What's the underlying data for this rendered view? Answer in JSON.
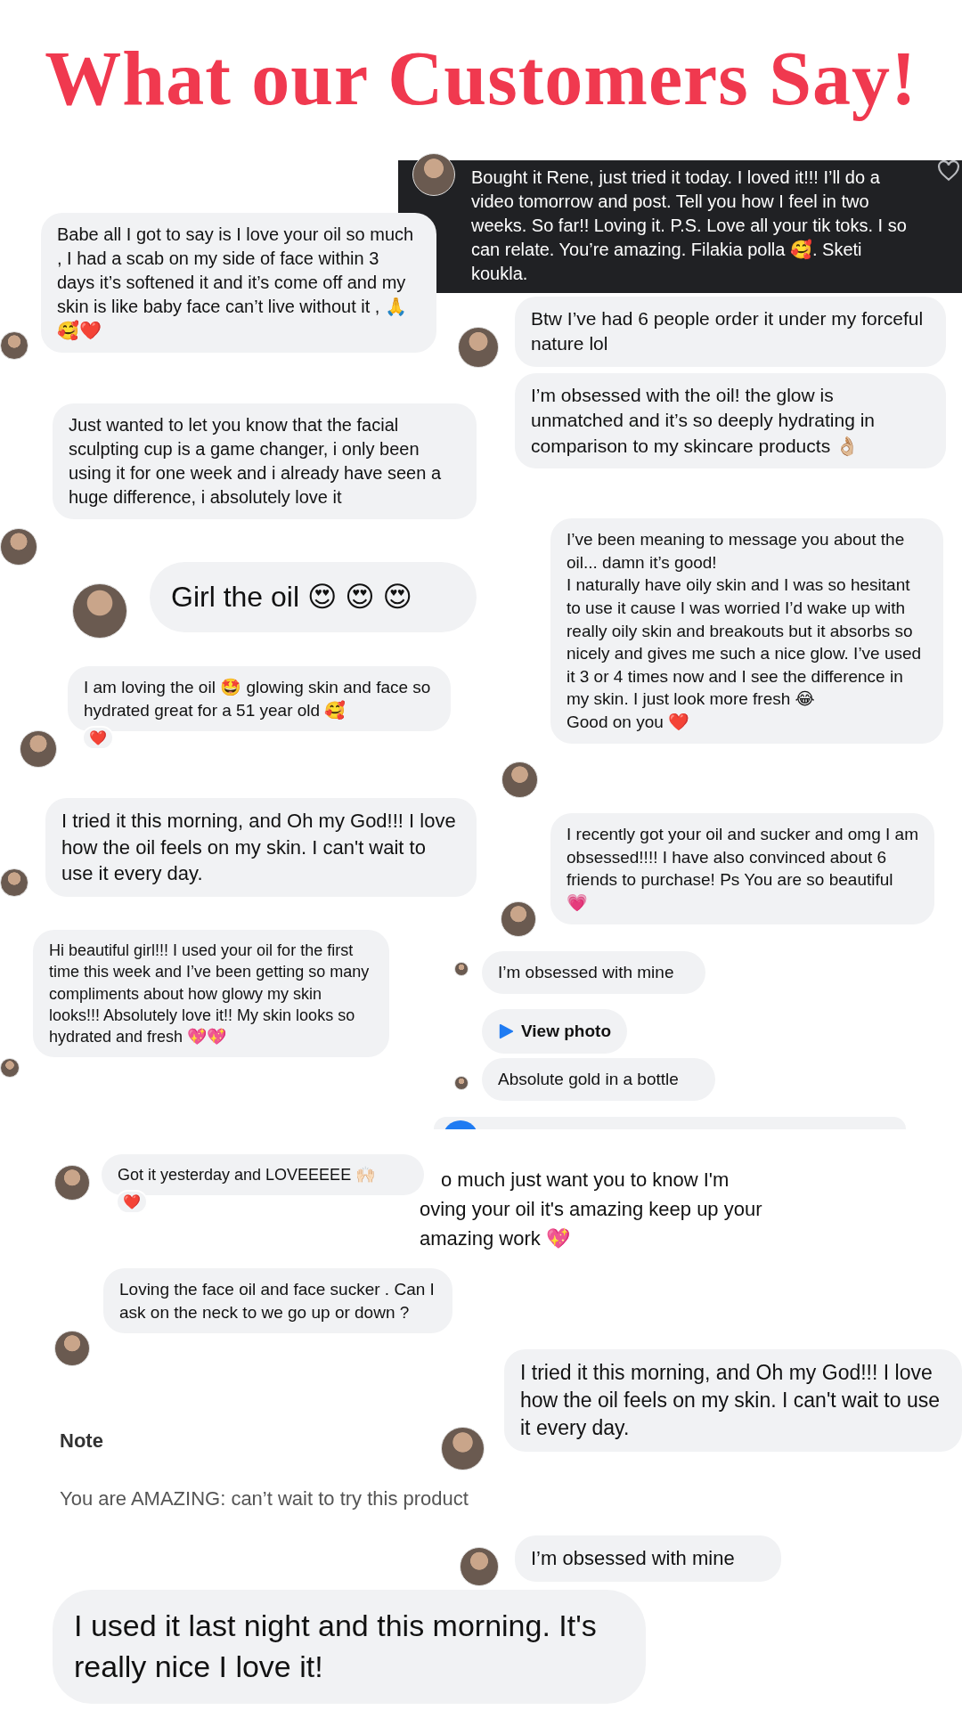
{
  "title": "What our Customers Say!",
  "messages": [
    {
      "kind": "dark",
      "text": "Bought it Rene, just tried it today. I loved it!!! I’ll do a video tomorrow and post. Tell you how I feel in two weeks. So far!! Loving it. P.S. Love all your tik toks. I so can relate. You’re amazing. Filakia polla 🥰. Sketi koukla.",
      "avatar": true
    },
    {
      "kind": "bubble",
      "text": "Babe all I got to say is I love your oil so much , I had a scab on my side of face within 3 days it’s softened it and it’s come off and my skin is like baby face can’t live without it , 🙏🥰❤️",
      "avatar": true
    },
    {
      "kind": "bubble",
      "text": "Btw I’ve had 6 people order it under my forceful nature lol",
      "avatar": true
    },
    {
      "kind": "bubble",
      "text": "I’m obsessed with the oil! the glow is unmatched and it’s so deeply hydrating in comparison to my skincare products 👌🏼",
      "avatar": false
    },
    {
      "kind": "bubble",
      "text": "Just wanted to let you know that the facial sculpting cup is a game changer, i only been using it for one week and i already have seen a huge difference, i absolutely love it",
      "avatar": true
    },
    {
      "kind": "large",
      "text": "Girl the oil 😍 😍 😍",
      "avatar": true
    },
    {
      "kind": "bubble",
      "text": "I am loving the oil 🤩 glowing skin and face so hydrated great for a 51 year old 🥰",
      "avatar": true,
      "reaction": "❤️"
    },
    {
      "kind": "bubble",
      "text": "I’ve been meaning to message you about the oil... damn it’s good!\nI naturally have oily skin and I was so hesitant to use it cause I was worried I’d wake up with really oily skin and breakouts but it absorbs so nicely and gives me such a nice glow. I’ve used it 3 or 4 times now and I see the difference in my skin. I just look more fresh 😂\nGood on you ❤️",
      "avatar": true
    },
    {
      "kind": "bubble",
      "text": "I tried it this morning, and Oh my God!!! I love how the oil feels on my skin. I can't wait to use it every day.",
      "avatar": true
    },
    {
      "kind": "bubble",
      "text": "I recently got your oil and sucker and omg I am obsessed!!!! I have also convinced about 6 friends to purchase! Ps You are so beautiful 💗",
      "avatar": true
    },
    {
      "kind": "bubble",
      "text": "Hi beautiful girl!!! I used your oil for the first time this week and I’ve been getting so many compliments about how glowy my skin looks!!! Absolutely love it!! My skin looks so hydrated and fresh 💖💖",
      "avatar": true
    },
    {
      "kind": "bubble",
      "text": "I’m obsessed with mine",
      "avatar": true
    },
    {
      "kind": "link",
      "text": "View photo",
      "avatar": false
    },
    {
      "kind": "bubble",
      "text": "Absolute gold in a bottle",
      "avatar": true
    },
    {
      "kind": "bubble",
      "text": "Got it yesterday and LOVEEEEE 🙌🏻",
      "avatar": true,
      "reaction": "❤️"
    },
    {
      "kind": "plain",
      "text": "o much just want you to know I'm\noving your oil it's amazing keep up your\namazing work 💖",
      "avatar": false
    },
    {
      "kind": "bubble",
      "text": "Loving the face oil and face sucker . Can I ask on the neck to we go up or down ?",
      "avatar": true
    },
    {
      "kind": "bubble",
      "text": "I tried it this morning, and Oh my God!!! I love how the oil feels on my skin. I can't wait to use it every day.",
      "avatar": true
    },
    {
      "kind": "note_label",
      "text": "Note",
      "avatar": false
    },
    {
      "kind": "note",
      "text": "You are AMAZING: can’t wait to try this product",
      "avatar": false
    },
    {
      "kind": "bubble",
      "text": "I’m obsessed with mine",
      "avatar": true
    },
    {
      "kind": "large",
      "text": "I used it last night and this morning. It's really nice I love it!",
      "avatar": false
    }
  ]
}
